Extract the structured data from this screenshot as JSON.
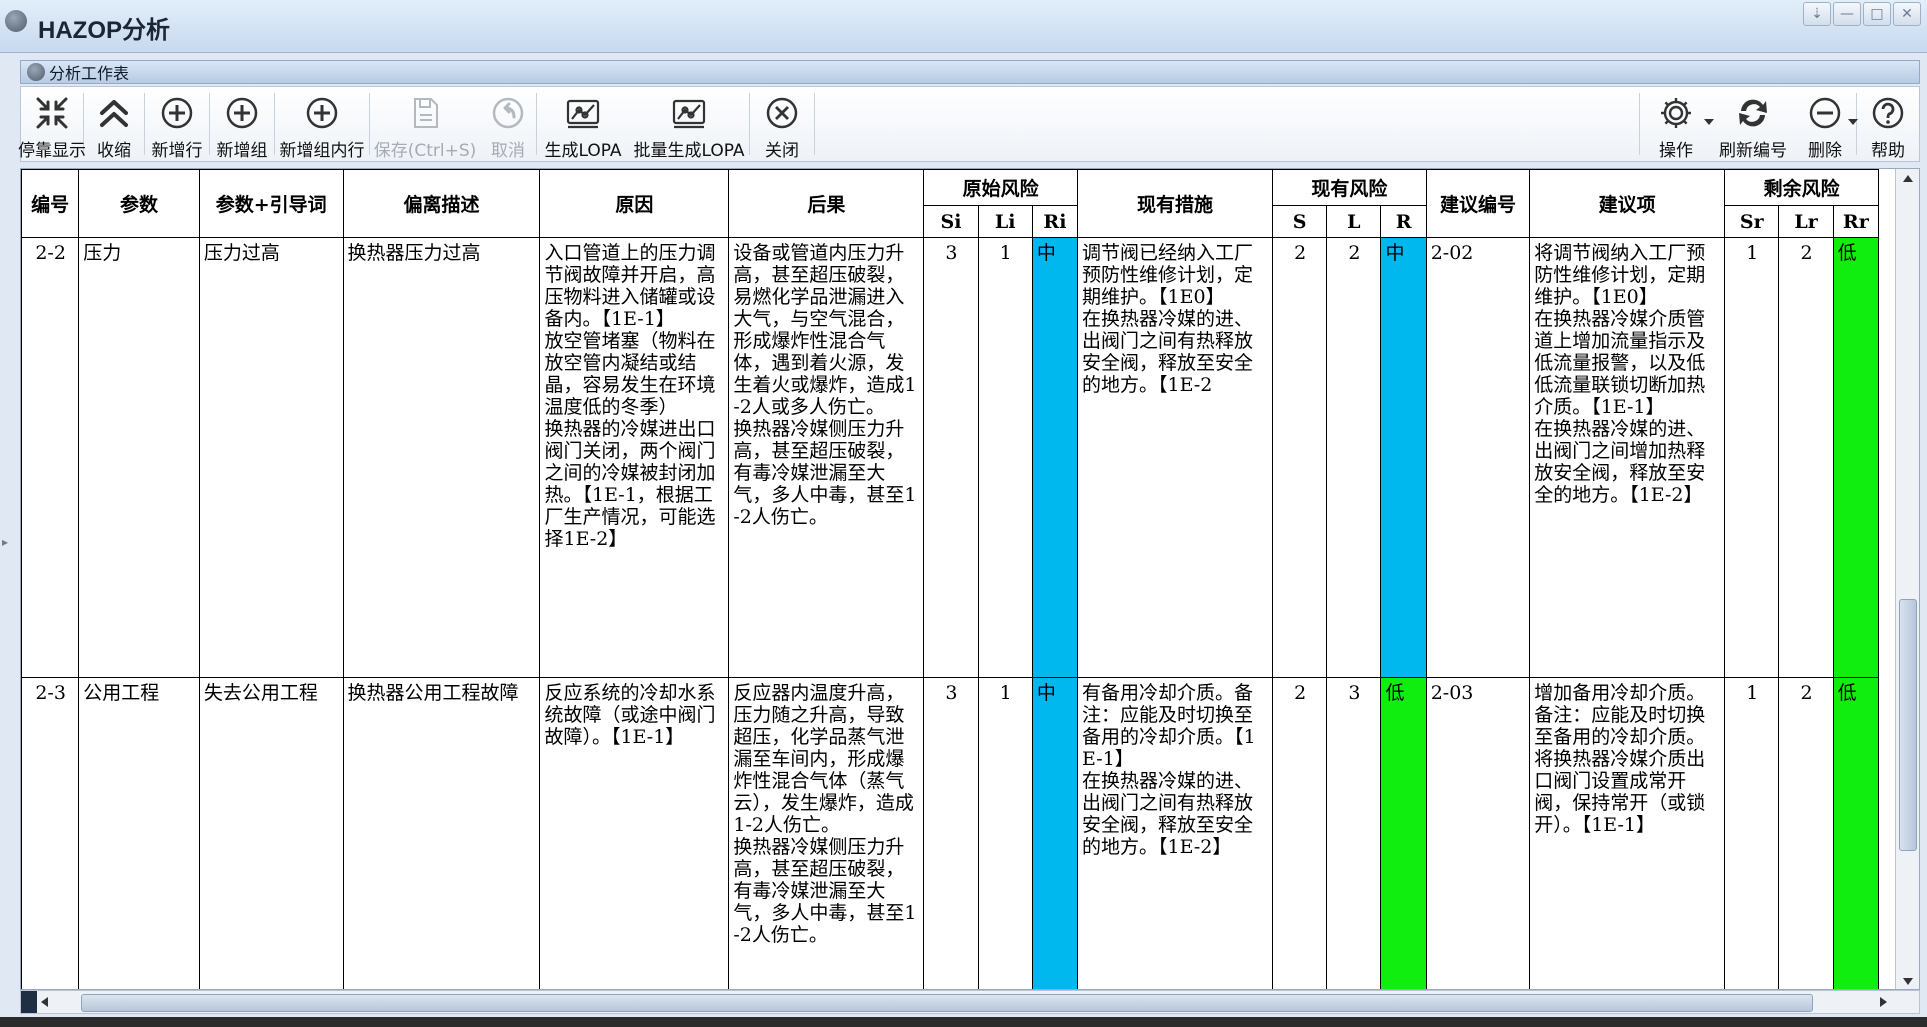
{
  "app": {
    "title": "HAZOP分析"
  },
  "window_controls": {
    "pin": "⇣",
    "minimize": "—",
    "maximize": "□",
    "close": "✕"
  },
  "panel": {
    "title": "分析工作表"
  },
  "toolbar": {
    "dock_display": "停靠显示",
    "collapse": "收缩",
    "add_row": "新增行",
    "add_group": "新增组",
    "add_group_row": "新增组内行",
    "save": "保存(Ctrl+S)",
    "cancel": "取消",
    "generate_lopa": "生成LOPA",
    "batch_generate_lopa": "批量生成LOPA",
    "close": "关闭",
    "operate": "操作",
    "refresh_number": "刷新编号",
    "delete": "删除",
    "help": "帮助"
  },
  "table": {
    "headers": {
      "id": "编号",
      "param": "参数",
      "param_guide": "参数+引导词",
      "deviation": "偏离描述",
      "cause": "原因",
      "consequence": "后果",
      "raw_risk": "原始风险",
      "si": "Si",
      "li": "Li",
      "ri": "Ri",
      "existing_measures": "现有措施",
      "current_risk": "现有风险",
      "s": "S",
      "l": "L",
      "r": "R",
      "suggestion_id": "建议编号",
      "suggestion": "建议项",
      "residual_risk": "剩余风险",
      "sr": "Sr",
      "lr": "Lr",
      "rr": "Rr"
    },
    "rows": [
      {
        "id": "2-2",
        "param": "压力",
        "param_guide": "压力过高",
        "deviation": "换热器压力过高",
        "cause": "入口管道上的压力调节阀故障并开启，高压物料进入储罐或设备内。【1E-1】\n放空管堵塞（物料在放空管内凝结或结晶，容易发生在环境温度低的冬季）\n换热器的冷媒进出口阀门关闭，两个阀门之间的冷媒被封闭加热。【1E-1，根据工厂生产情况，可能选择1E-2】",
        "consequence": "设备或管道内压力升高，甚至超压破裂，易燃化学品泄漏进入大气，与空气混合，形成爆炸性混合气体，遇到着火源，发生着火或爆炸，造成1-2人或多人伤亡。\n换热器冷媒侧压力升高，甚至超压破裂，有毒冷媒泄漏至大气，多人中毒，甚至1-2人伤亡。",
        "si": "3",
        "li": "1",
        "ri": "中",
        "existing_measures": "调节阀已经纳入工厂预防性维修计划，定期维护。【1E0】\n在换热器冷媒的进、出阀门之间有热释放安全阀，释放至安全的地方。【1E-2",
        "s": "2",
        "l": "2",
        "r": "中",
        "suggestion_id": "2-02",
        "suggestion": "将调节阀纳入工厂预防性维修计划，定期维护。【1E0】\n在换热器冷媒介质管道上增加流量指示及低流量报警，以及低低流量联锁切断加热介质。【1E-1】\n在换热器冷媒的进、出阀门之间增加热释放安全阀，释放至安全的地方。【1E-2】",
        "sr": "1",
        "lr": "2",
        "rr": "低"
      },
      {
        "id": "2-3",
        "param": "公用工程",
        "param_guide": "失去公用工程",
        "deviation": "换热器公用工程故障",
        "cause": "反应系统的冷却水系统故障（或途中阀门故障）。【1E-1】",
        "consequence": "反应器内温度升高，压力随之升高，导致超压，化学品蒸气泄漏至车间内，形成爆炸性混合气体（蒸气云），发生爆炸，造成1-2人伤亡。\n换热器冷媒侧压力升高，甚至超压破裂，有毒冷媒泄漏至大气，多人中毒，甚至1-2人伤亡。",
        "si": "3",
        "li": "1",
        "ri": "中",
        "existing_measures": "有备用冷却介质。备注：应能及时切换至备用的冷却介质。【1E-1】\n在换热器冷媒的进、出阀门之间有热释放安全阀，释放至安全的地方。【1E-2】",
        "s": "2",
        "l": "3",
        "r": "低",
        "suggestion_id": "2-03",
        "suggestion": "增加备用冷却介质。备注：应能及时切换至备用的冷却介质。\n将换热器冷媒介质出口阀门设置成常开阀，保持常开（或锁开）。【1E-1】",
        "sr": "1",
        "lr": "2",
        "rr": "低"
      }
    ]
  },
  "colors": {
    "risk_mid": "#00b7ee",
    "risk_low": "#10ee10"
  },
  "icons": [
    "dock-icon",
    "collapse-icon",
    "add-row-icon",
    "add-group-icon",
    "add-group-row-icon",
    "save-icon",
    "cancel-icon",
    "lopa-icon",
    "batch-lopa-icon",
    "close-icon",
    "gear-icon",
    "refresh-icon",
    "minus-icon",
    "help-icon"
  ]
}
